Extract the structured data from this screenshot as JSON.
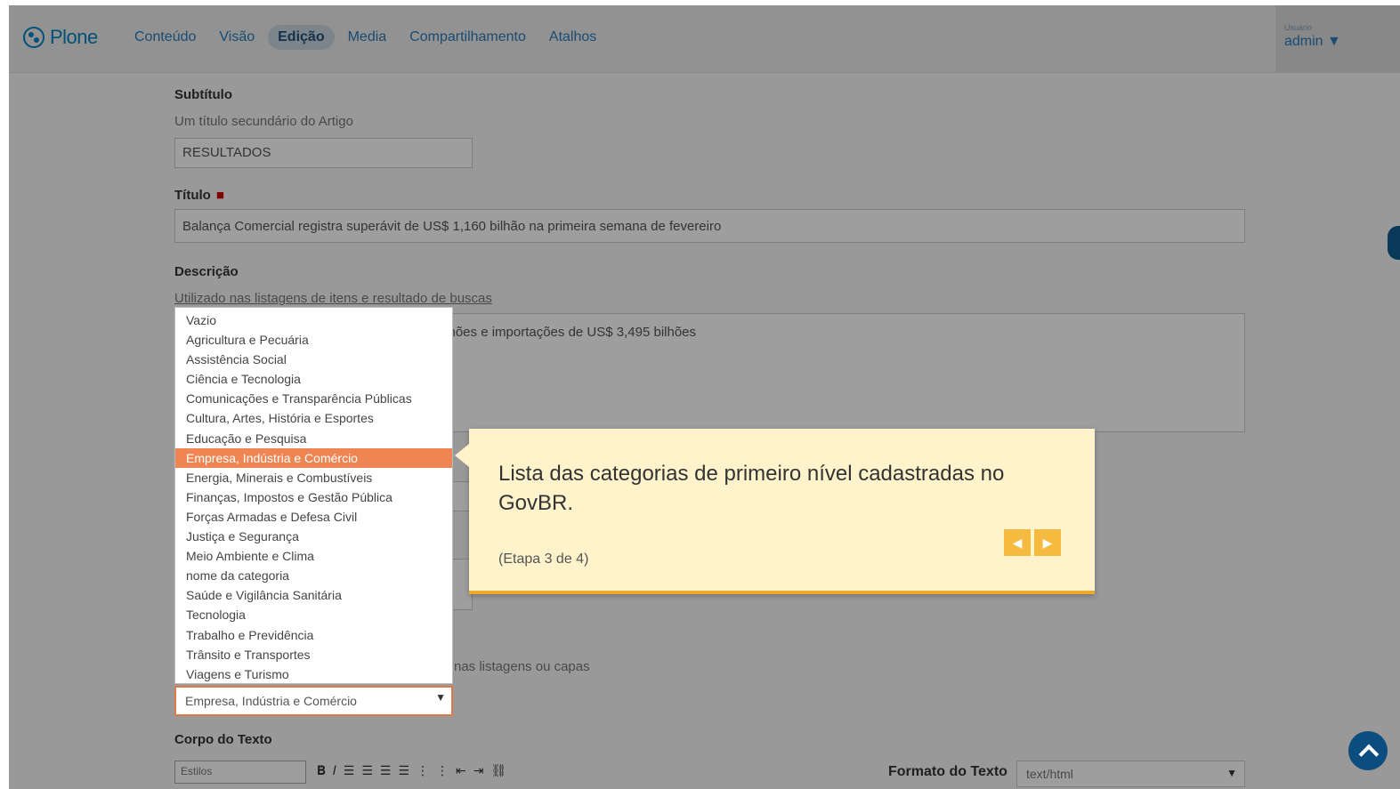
{
  "toolbar": {
    "logo": "Plone",
    "nav": [
      "Conteúdo",
      "Visão",
      "Edição",
      "Media",
      "Compartilhamento",
      "Atalhos"
    ],
    "active_nav": "Edição",
    "user_label": "Usuário",
    "user_name": "admin ▼"
  },
  "form": {
    "subtitle_label": "Subtítulo",
    "subtitle_help": "Um título secundário do Artigo",
    "subtitle_value": "RESULTADOS",
    "title_label": "Título",
    "title_required": "■",
    "title_value": "Balança Comercial registra superávit de US$ 1,160 bilhão na primeira semana de fevereiro",
    "description_label": "Descrição",
    "description_help": "Utilizado nas listagens de itens e resultado de buscas",
    "description_value": "Exportações foram no valor de US$ 4,656 bilhões e importações de US$ 3,495 bilhões",
    "image_help_fragment": "nas listagens ou capas",
    "body_label": "Corpo do Texto"
  },
  "dropdown": {
    "items": [
      "Vazio",
      "Agricultura e Pecuária",
      "Assistência Social",
      "Ciência e Tecnologia",
      "Comunicações e Transparência Públicas",
      "Cultura, Artes, História e Esportes",
      "Educação e Pesquisa",
      "Empresa, Indústria e Comércio",
      "Energia, Minerais e Combustíveis",
      "Finanças, Impostos e Gestão Pública",
      "Forças Armadas e Defesa Civil",
      "Justiça e Segurança",
      "Meio Ambiente e Clima",
      "nome da categoria",
      "Saúde e Vigilância Sanitária",
      "Tecnologia",
      "Trabalho e Previdência",
      "Trânsito e Transportes",
      "Viagens e Turismo"
    ],
    "selected": "Empresa, Indústria e Comércio"
  },
  "tooltip": {
    "text": "Lista das categorias de primeiro nível cadastradas no GovBR.",
    "step": "(Etapa 3 de 4)",
    "prev": "◀",
    "next": "▶"
  },
  "editor": {
    "style_select": "Estilos",
    "format_label": "Formato do Texto",
    "format_value": "text/html"
  }
}
